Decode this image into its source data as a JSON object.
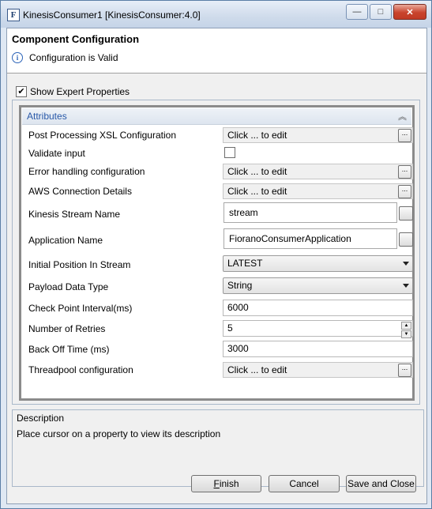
{
  "window": {
    "app_icon_letter": "F",
    "title": "KinesisConsumer1 [KinesisConsumer:4.0]",
    "minimize_glyph": "—",
    "maximize_glyph": "□",
    "close_glyph": "✕"
  },
  "header": {
    "title": "Component Configuration",
    "info_glyph": "i",
    "status": "Configuration is Valid"
  },
  "expert": {
    "label": "Show Expert Properties",
    "checked_glyph": "✔"
  },
  "attributes": {
    "title": "Attributes",
    "collapse_glyph": "︽",
    "rows": {
      "post_xsl": {
        "label": "Post Processing XSL Configuration",
        "value": "Click ... to edit"
      },
      "validate_input": {
        "label": "Validate input"
      },
      "error_handling": {
        "label": "Error handling configuration",
        "value": "Click ... to edit"
      },
      "aws_connection": {
        "label": "AWS Connection Details",
        "value": "Click ... to edit"
      },
      "stream_name": {
        "label": "Kinesis Stream Name",
        "value": "stream"
      },
      "application_name": {
        "label": "Application Name",
        "value": "FioranoConsumerApplication"
      },
      "initial_position": {
        "label": "Initial Position In Stream",
        "value": "LATEST"
      },
      "payload_type": {
        "label": "Payload Data Type",
        "value": "String"
      },
      "checkpoint_interval": {
        "label": "Check Point Interval(ms)",
        "value": "6000"
      },
      "num_retries": {
        "label": "Number of Retries",
        "value": "5"
      },
      "backoff_time": {
        "label": "Back Off Time (ms)",
        "value": "3000"
      },
      "threadpool": {
        "label": "Threadpool configuration",
        "value": "Click ... to edit"
      }
    },
    "dots_label": "...",
    "spin_up": "▲",
    "spin_down": "▼"
  },
  "description": {
    "title": "Description",
    "text": "Place cursor on a property to view its description"
  },
  "buttons": {
    "finish_mnemonic": "F",
    "finish_rest": "inish",
    "cancel": "Cancel",
    "save_close": "Save and Close"
  }
}
